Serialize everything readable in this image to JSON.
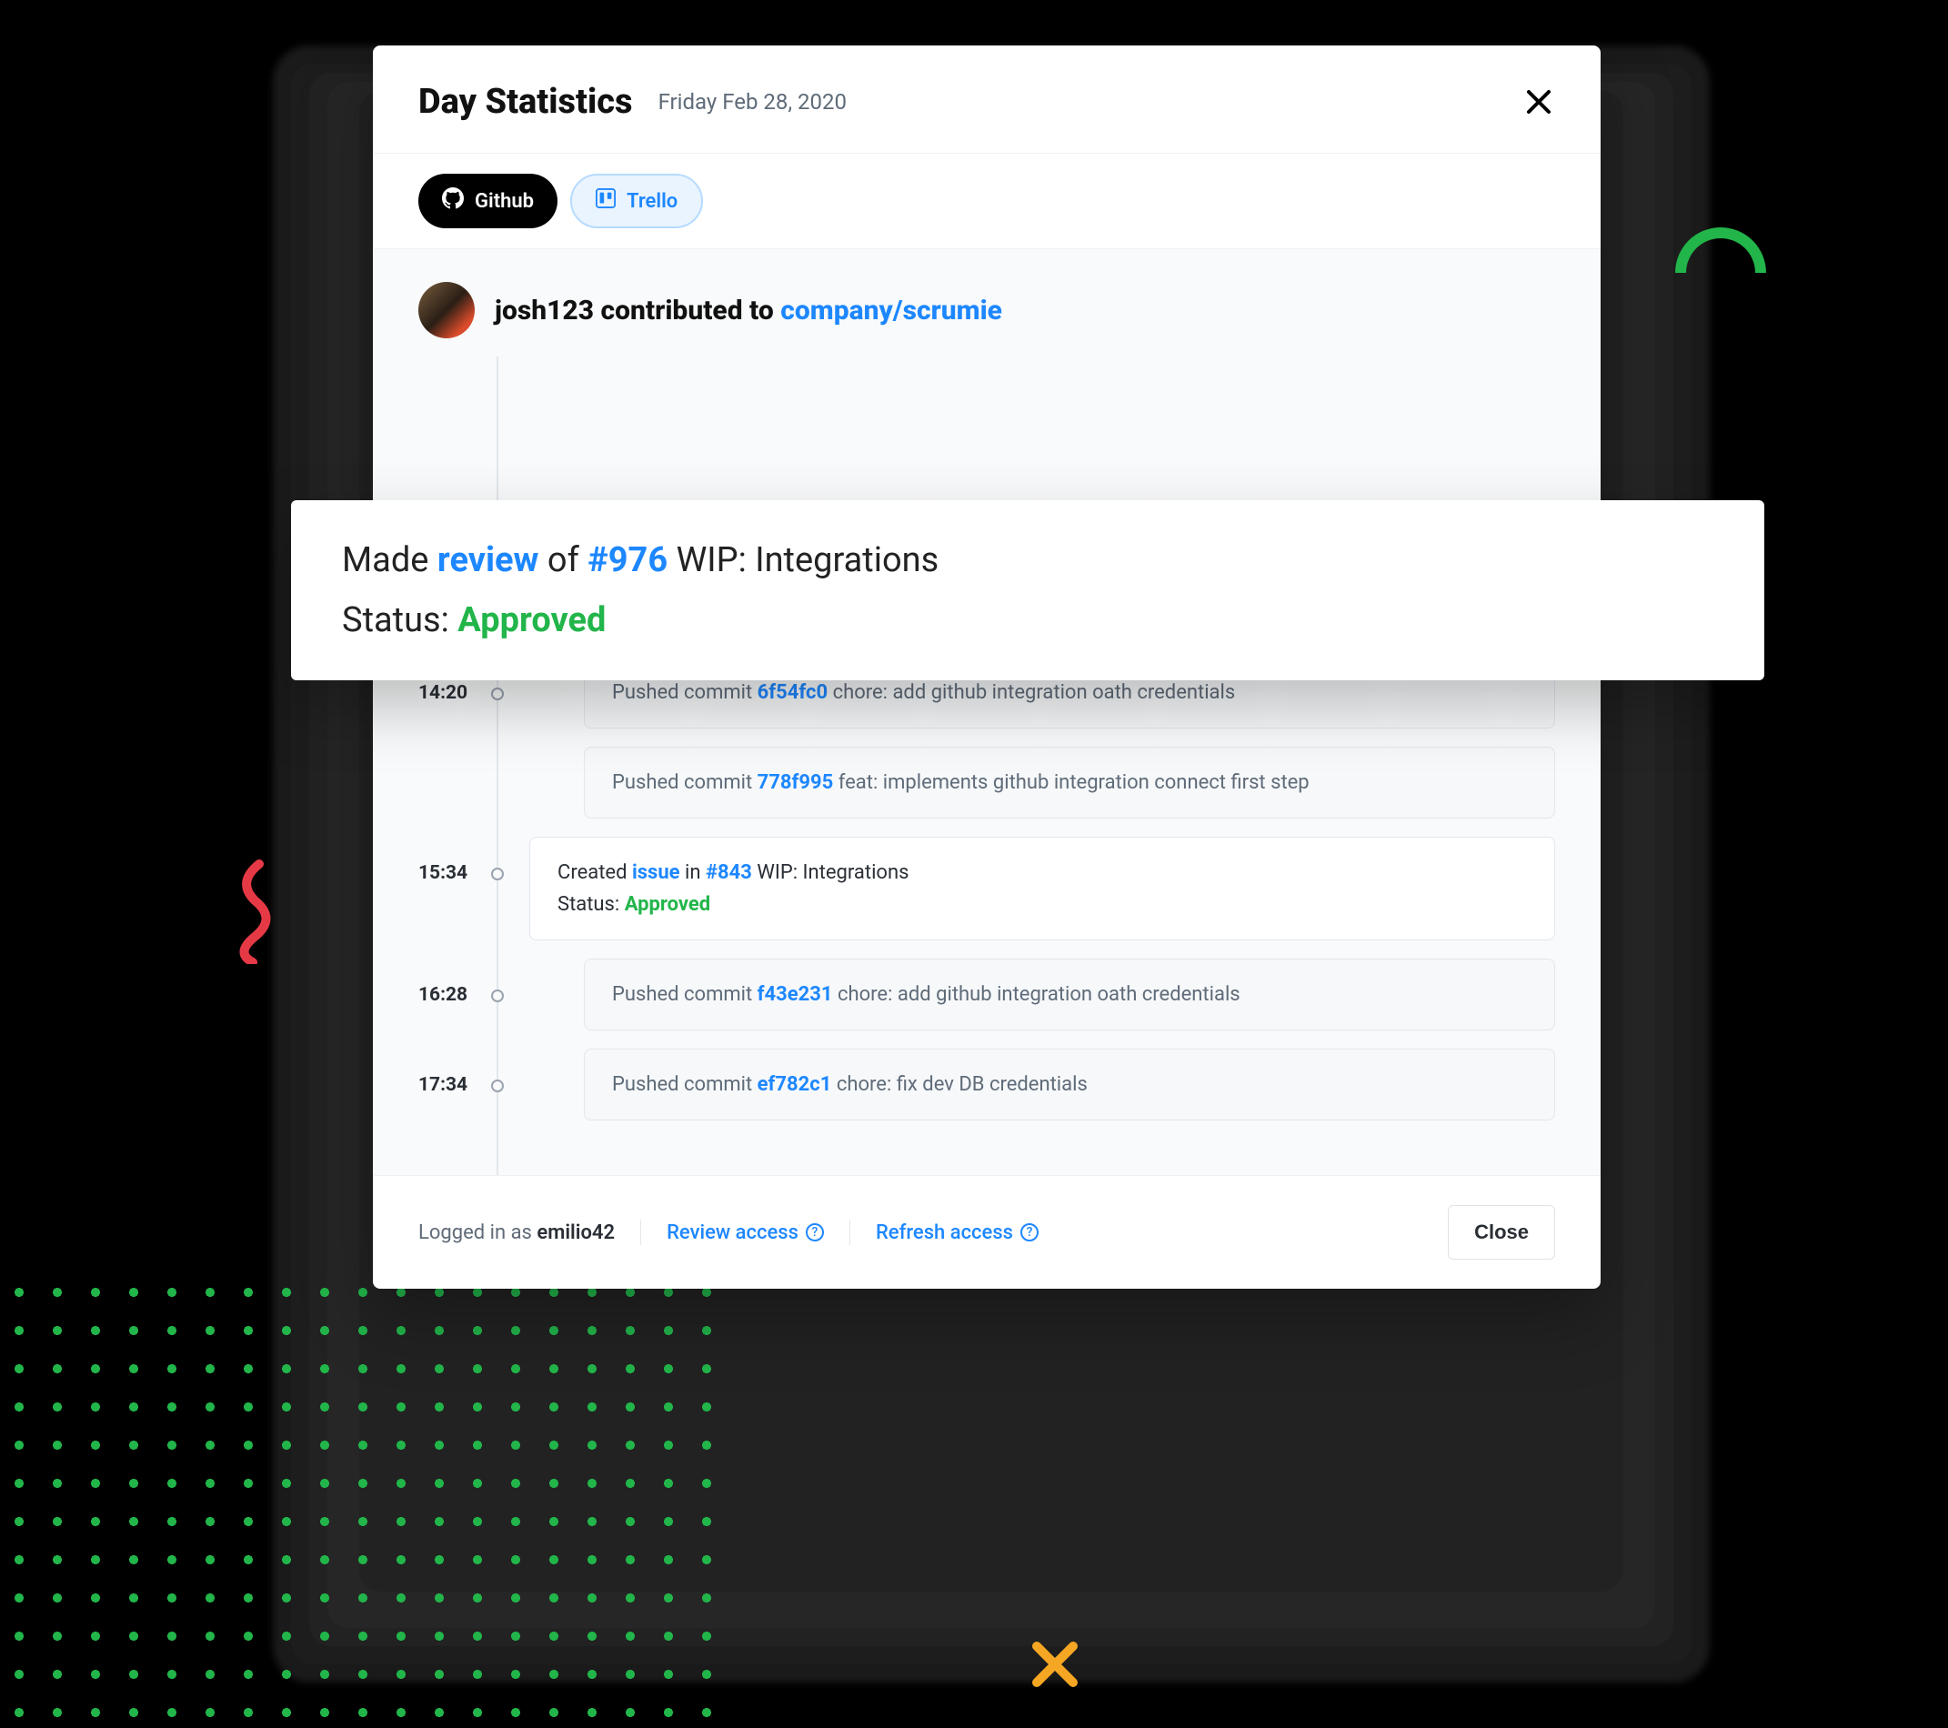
{
  "header": {
    "title": "Day Statistics",
    "date": "Friday Feb 28, 2020"
  },
  "tabs": {
    "github": "Github",
    "trello": "Trello"
  },
  "contribution": {
    "user": "josh123",
    "verb": "contributed to",
    "repo": "company/scrumie"
  },
  "popout": {
    "prefix": "Made",
    "action": "review",
    "of": "of",
    "issue": "#976",
    "title": "WIP: Integrations",
    "status_label": "Status:",
    "status_value": "Approved"
  },
  "timeline": [
    {
      "time": "14:20",
      "cards": [
        {
          "kind": "commit",
          "indent": true,
          "prefix": "Pushed commit",
          "hash": "6f54fc0",
          "msg": "chore: add github integration oath credentials"
        },
        {
          "kind": "commit",
          "indent": true,
          "prefix": "Pushed commit",
          "hash": "778f995",
          "msg": "feat: implements github integration connect first step"
        }
      ]
    },
    {
      "time": "15:34",
      "cards": [
        {
          "kind": "issue",
          "indent": false,
          "prefix": "Created",
          "action": "issue",
          "in": "in",
          "issue": "#843",
          "title": "WIP: Integrations",
          "status_label": "Status:",
          "status_value": "Approved"
        }
      ]
    },
    {
      "time": "16:28",
      "cards": [
        {
          "kind": "commit",
          "indent": true,
          "prefix": "Pushed commit",
          "hash": "f43e231",
          "msg": "chore: add github integration oath credentials"
        }
      ]
    },
    {
      "time": "17:34",
      "cards": [
        {
          "kind": "commit",
          "indent": true,
          "prefix": "Pushed commit",
          "hash": "ef782c1",
          "msg": "chore: fix dev DB credentials"
        }
      ]
    }
  ],
  "footer": {
    "logged_prefix": "Logged in as",
    "username": "emilio42",
    "review_access": "Review access",
    "refresh_access": "Refresh access",
    "close": "Close"
  }
}
